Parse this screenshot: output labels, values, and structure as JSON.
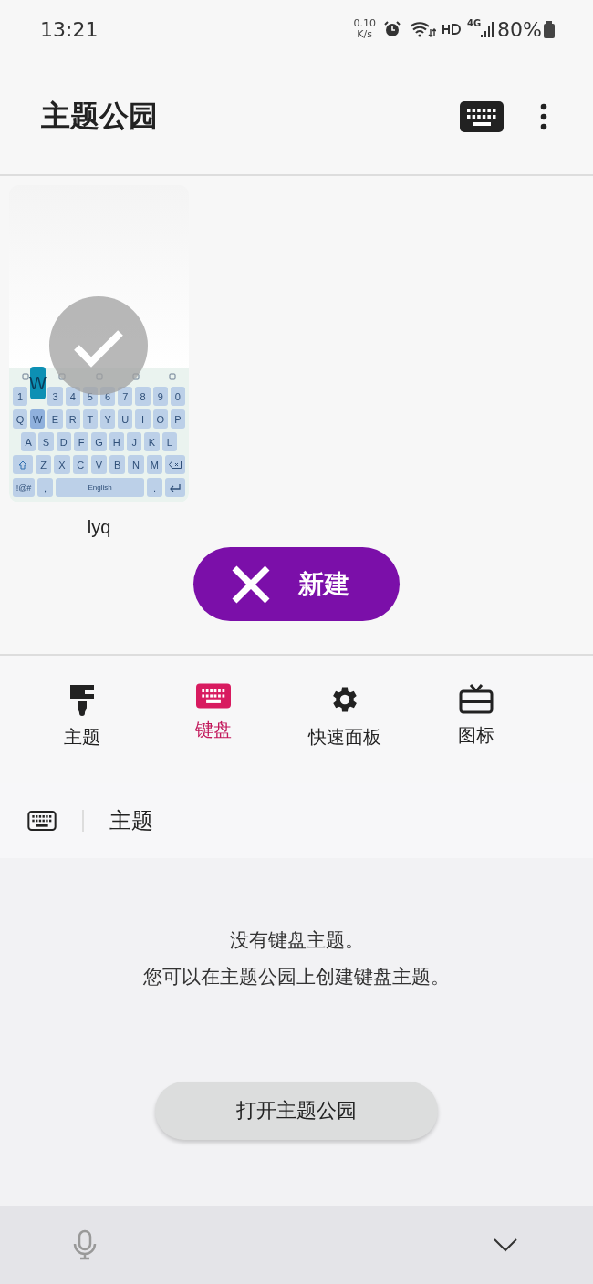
{
  "status_bar": {
    "time": "13:21",
    "speed_value": "0.10",
    "speed_unit": "K/s",
    "network": "4G",
    "battery": "80%"
  },
  "app_bar": {
    "title": "主题公园"
  },
  "themes": [
    {
      "name": "lyq",
      "selected": true,
      "preview": {
        "popup_key": "W",
        "rows": [
          {
            "keys": [
              {
                "kind": "char",
                "label": "1"
              },
              {
                "kind": "gap"
              },
              {
                "kind": "char",
                "label": "3"
              },
              {
                "kind": "char",
                "label": "4"
              },
              {
                "kind": "char",
                "label": "5"
              },
              {
                "kind": "char",
                "label": "6"
              },
              {
                "kind": "char",
                "label": "7"
              },
              {
                "kind": "char",
                "label": "8"
              },
              {
                "kind": "char",
                "label": "9"
              },
              {
                "kind": "char",
                "label": "0"
              }
            ]
          },
          {
            "keys": [
              {
                "kind": "char",
                "label": "Q"
              },
              {
                "kind": "char",
                "label": "W",
                "pressed": true
              },
              {
                "kind": "char",
                "label": "E"
              },
              {
                "kind": "char",
                "label": "R"
              },
              {
                "kind": "char",
                "label": "T"
              },
              {
                "kind": "char",
                "label": "Y"
              },
              {
                "kind": "char",
                "label": "U"
              },
              {
                "kind": "char",
                "label": "I"
              },
              {
                "kind": "char",
                "label": "O"
              },
              {
                "kind": "char",
                "label": "P"
              }
            ]
          },
          {
            "keys": [
              {
                "kind": "char",
                "label": "A"
              },
              {
                "kind": "char",
                "label": "S"
              },
              {
                "kind": "char",
                "label": "D"
              },
              {
                "kind": "char",
                "label": "F"
              },
              {
                "kind": "char",
                "label": "G"
              },
              {
                "kind": "char",
                "label": "H"
              },
              {
                "kind": "char",
                "label": "J"
              },
              {
                "kind": "char",
                "label": "K"
              },
              {
                "kind": "char",
                "label": "L"
              }
            ]
          },
          {
            "keys": [
              {
                "kind": "shift"
              },
              {
                "kind": "char",
                "label": "Z"
              },
              {
                "kind": "char",
                "label": "X"
              },
              {
                "kind": "char",
                "label": "C"
              },
              {
                "kind": "char",
                "label": "V"
              },
              {
                "kind": "char",
                "label": "B"
              },
              {
                "kind": "char",
                "label": "N"
              },
              {
                "kind": "char",
                "label": "M"
              },
              {
                "kind": "backspace"
              }
            ]
          },
          {
            "keys": [
              {
                "kind": "wide",
                "label": "!@#"
              },
              {
                "kind": "char",
                "label": ","
              },
              {
                "kind": "space",
                "label": "English"
              },
              {
                "kind": "char",
                "label": "."
              },
              {
                "kind": "enter"
              }
            ]
          }
        ]
      }
    }
  ],
  "new_button": {
    "label": "新建"
  },
  "tabs": [
    {
      "label": "主题",
      "selected": false
    },
    {
      "label": "键盘",
      "selected": true
    },
    {
      "label": "快速面板",
      "selected": false
    },
    {
      "label": "图标",
      "selected": false
    }
  ],
  "filter": {
    "label": "主题"
  },
  "empty_state": {
    "lines": [
      "没有键盘主题。",
      "您可以在主题公园上创建键盘主题。"
    ],
    "button": "打开主题公园"
  }
}
